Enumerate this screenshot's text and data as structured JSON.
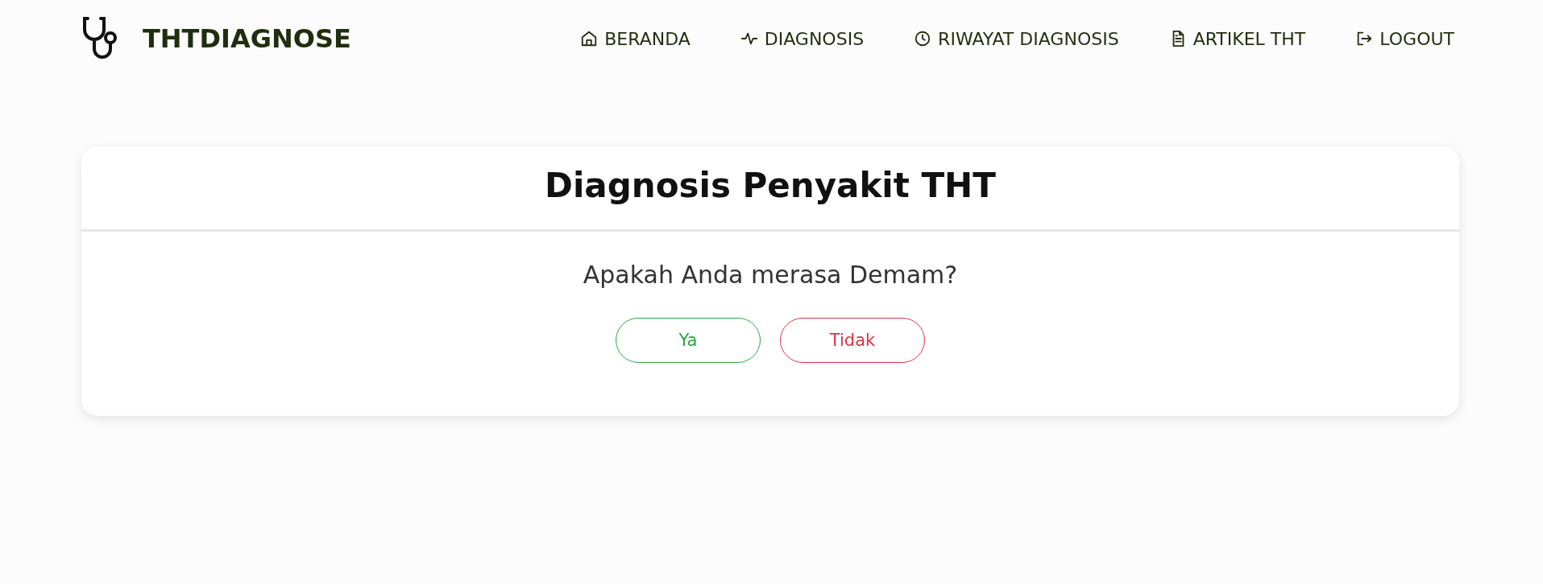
{
  "brand": {
    "name": "THTDIAGNOSE"
  },
  "nav": [
    {
      "label": "BERANDA"
    },
    {
      "label": "DIAGNOSIS"
    },
    {
      "label": "RIWAYAT DIAGNOSIS"
    },
    {
      "label": "ARTIKEL THT"
    },
    {
      "label": "LOGOUT"
    }
  ],
  "card": {
    "title": "Diagnosis Penyakit THT",
    "question": "Apakah Anda merasa Demam?",
    "answers": [
      {
        "label": "Ya",
        "kind": "yes"
      },
      {
        "label": "Tidak",
        "kind": "no"
      }
    ]
  }
}
